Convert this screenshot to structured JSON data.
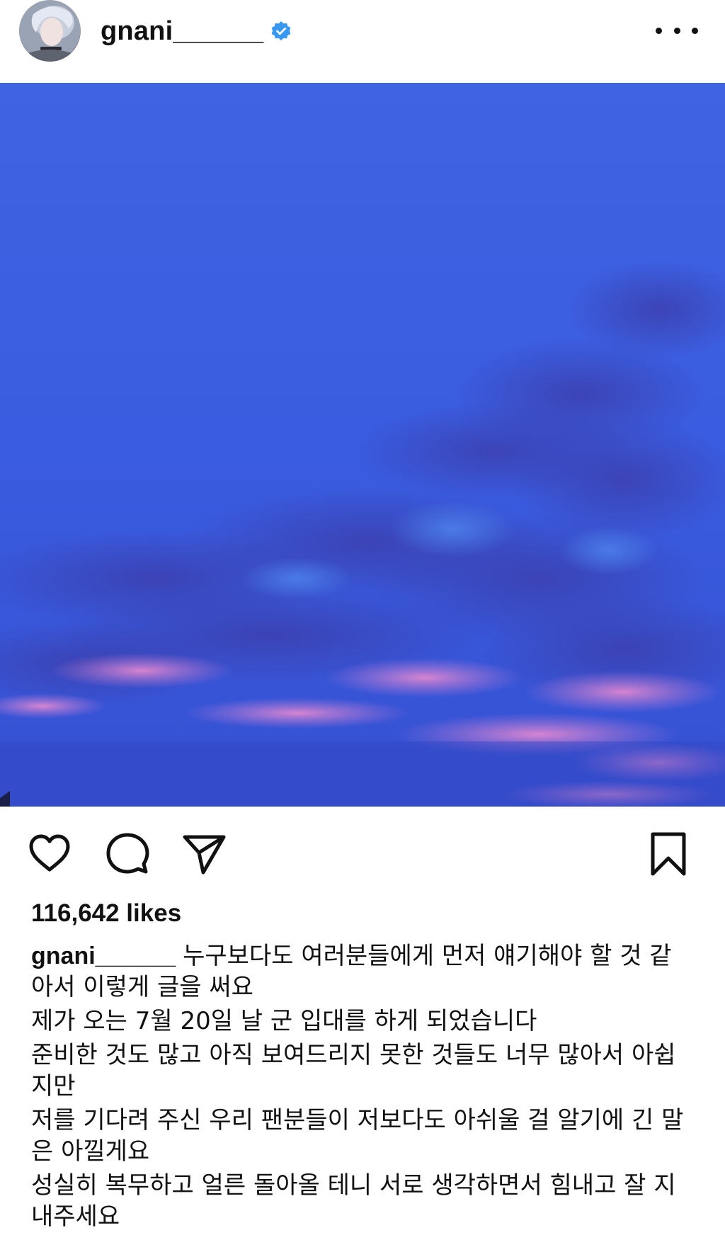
{
  "post": {
    "username": "gnani______",
    "likes": "116,642 likes",
    "caption_username": "gnani______",
    "caption_lines": [
      "누구보다도 여러분들에게 먼저 얘기해야 할 것 같아서 이렇게 글을 써요",
      "제가 오는 7월 20일 날 군 입대를 하게 되었습니다",
      "준비한 것도 많고 아직 보여드리지 못한 것들도 너무 많아서 아쉽지만",
      "저를 기다려 주신 우리 팬분들이 저보다도 아쉬울 걸 알기에 긴 말은 아낄게요",
      "성실히 복무하고 얼른 돌아올 테니 서로 생각하면서 힘내고 잘 지내주세요"
    ]
  },
  "icons": {
    "verified": "verified-badge-icon",
    "more": "more-options-icon",
    "like": "heart-icon",
    "comment": "comment-icon",
    "share": "send-icon",
    "save": "bookmark-icon"
  },
  "colors": {
    "verified_blue": "#3897f0",
    "sky_blue": "#3b5fe2",
    "cloud_pink": "#e88ad0"
  }
}
